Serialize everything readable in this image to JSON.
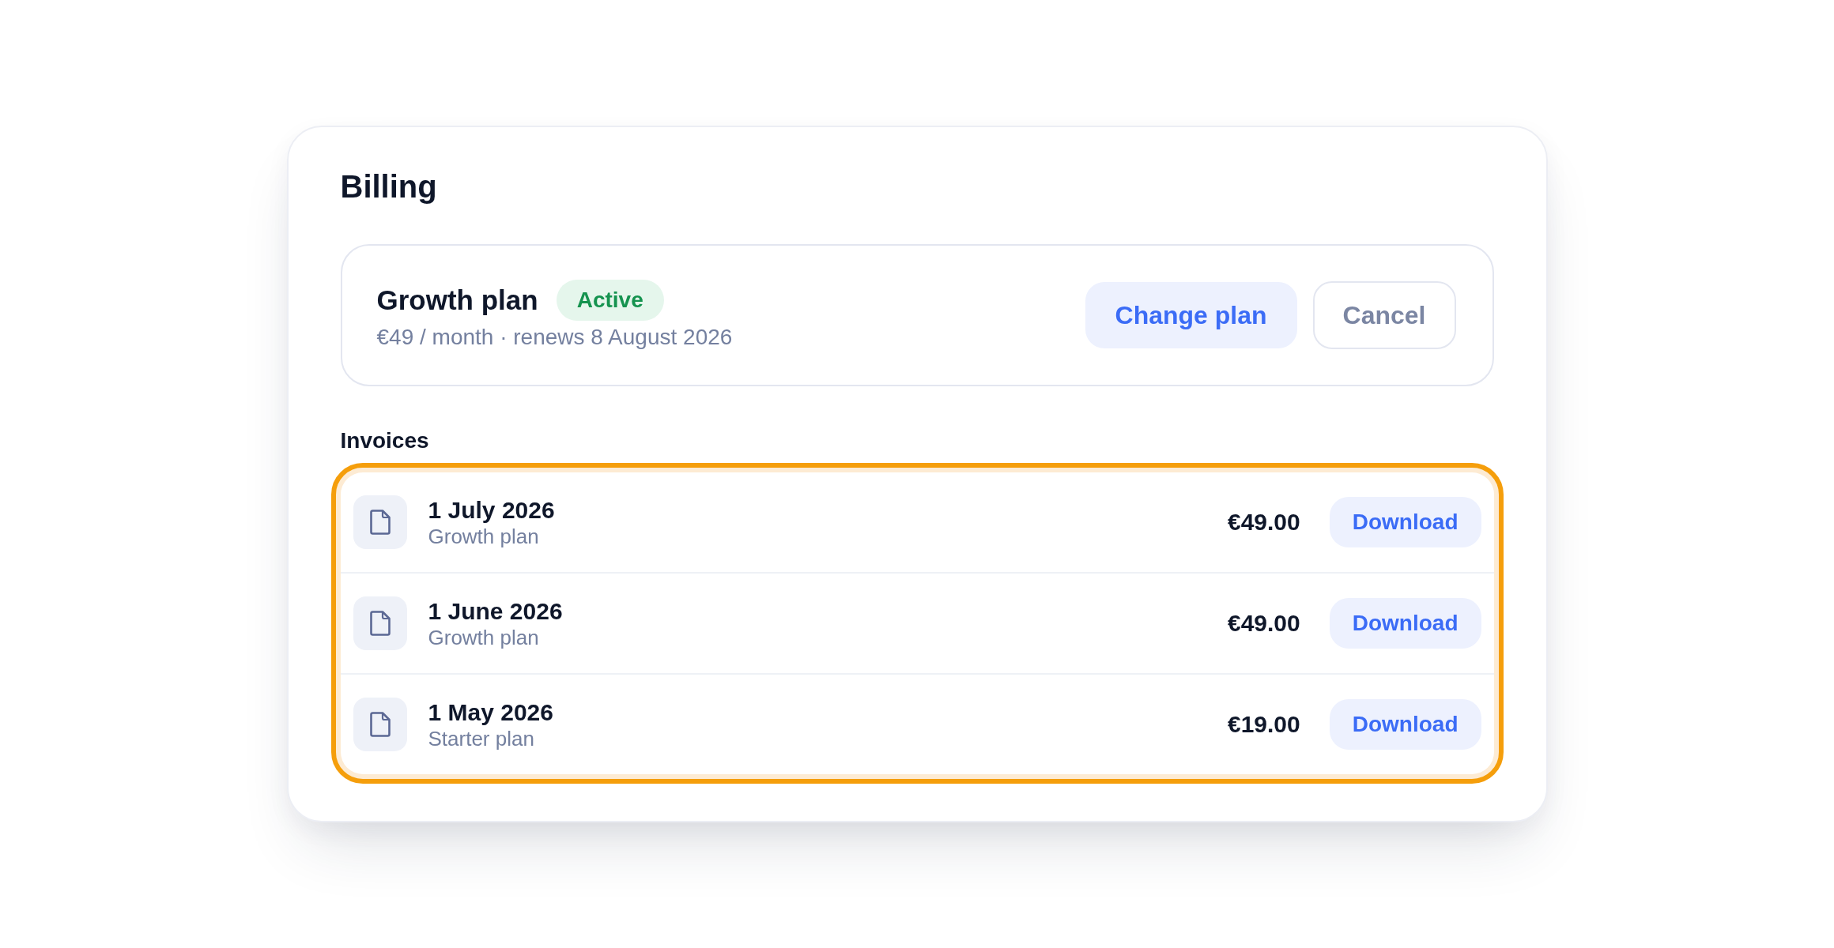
{
  "card": {
    "title": "Billing"
  },
  "plan": {
    "name": "Growth plan",
    "status": {
      "label": "Active",
      "kind": "success"
    },
    "details": "€49 / month · renews 8 August 2026",
    "actions": [
      {
        "label": "Change plan",
        "kind": "primary"
      },
      {
        "label": "Cancel",
        "kind": "secondary"
      }
    ]
  },
  "invoices": {
    "heading": "Invoices",
    "highlighted": true,
    "rows": [
      {
        "date": "1 July 2026",
        "plan": "Growth plan",
        "amount": "€49.00",
        "action": "Download"
      },
      {
        "date": "1 June 2026",
        "plan": "Growth plan",
        "amount": "€49.00",
        "action": "Download"
      },
      {
        "date": "1 May 2026",
        "plan": "Starter plan",
        "amount": "€19.00",
        "action": "Download"
      }
    ]
  }
}
